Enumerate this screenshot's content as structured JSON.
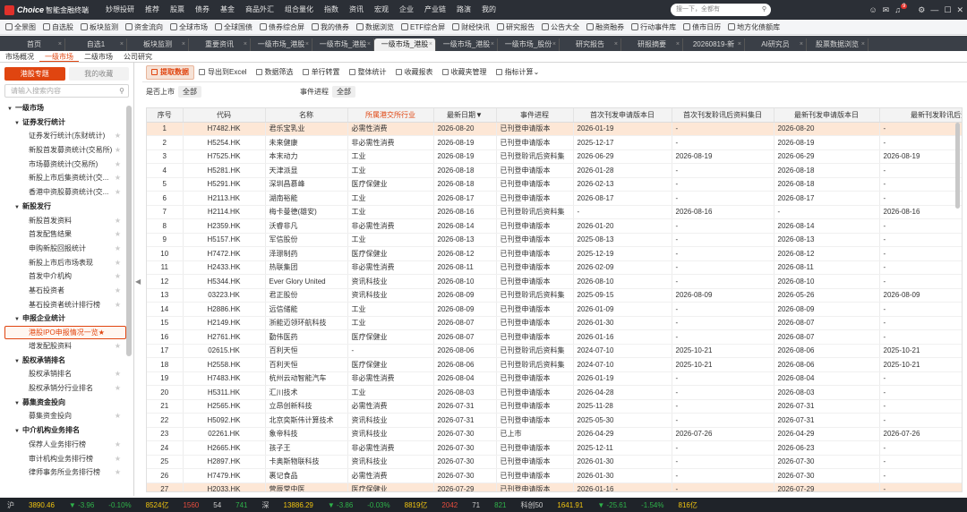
{
  "app": {
    "logo_brand": "Choice",
    "logo_name": "智能金融终端",
    "menu": [
      "妙想投研",
      "推荐",
      "股票",
      "债券",
      "基金",
      "商品外汇",
      "组合量化",
      "指数",
      "资讯",
      "宏观",
      "企业",
      "产业链",
      "路演",
      "我的"
    ],
    "search_placeholder": "搜一下，全都有",
    "search_icon": "search-icon",
    "notification_count": "9"
  },
  "toolbar": [
    "全景图",
    "自选股",
    "板块监测",
    "资金流向",
    "全球市场",
    "全球国债",
    "债券综合屏",
    "我的债券",
    "数据浏览",
    "ETF综合屏",
    "财经快讯",
    "研究报告",
    "公告大全",
    "融资融券",
    "行动事件库",
    "债市日历",
    "地方化债额库"
  ],
  "tabs": [
    "首页",
    "自选1",
    "板块监测",
    "重要资讯",
    "一级市场_港股",
    "一级市场_港股",
    "一级市场_港股",
    "一级市场_港股",
    "一级市场_股份",
    "研究报告",
    "研报摘要",
    "20260819-新",
    "AI研究员",
    "股票数据浏览"
  ],
  "active_tab_index": 6,
  "subtabs": [
    "市场概况",
    "一级市场",
    "二级市场",
    "公司研究"
  ],
  "active_subtab_index": 1,
  "sidebar": {
    "tabs": [
      "港股专题",
      "我的收藏"
    ],
    "search_placeholder": "请输入搜索内容",
    "tree": [
      {
        "level": "g1",
        "label": "一级市场"
      },
      {
        "level": "g2",
        "label": "证券发行统计"
      },
      {
        "level": "lf",
        "label": "证券发行统计(东财统计)"
      },
      {
        "level": "lf",
        "label": "新股首发募资统计(交易所)"
      },
      {
        "level": "lf",
        "label": "市场募资统计(交易所)"
      },
      {
        "level": "lf",
        "label": "新股上市后集资统计(交..."
      },
      {
        "level": "lf",
        "label": "香港中资股募资统计(交..."
      },
      {
        "level": "g2",
        "label": "新股发行"
      },
      {
        "level": "lf",
        "label": "新股首发资料"
      },
      {
        "level": "lf",
        "label": "首发配售结果"
      },
      {
        "level": "lf",
        "label": "申购新股回报统计"
      },
      {
        "level": "lf",
        "label": "新股上市后市场表现"
      },
      {
        "level": "lf",
        "label": "首发中介机构"
      },
      {
        "level": "lf",
        "label": "基石投资者"
      },
      {
        "level": "lf",
        "label": "基石投资者统计排行榜"
      },
      {
        "level": "g2",
        "label": "申报企业统计"
      },
      {
        "level": "sel",
        "label": "港股IPO申报情况一览"
      },
      {
        "level": "lf",
        "label": "增发配股资料"
      },
      {
        "level": "g2",
        "label": "股权承销排名"
      },
      {
        "level": "lf",
        "label": "股权承销排名"
      },
      {
        "level": "lf",
        "label": "股权承销分行业排名"
      },
      {
        "level": "g2",
        "label": "募集资金投向"
      },
      {
        "level": "lf",
        "label": "募集资金投向"
      },
      {
        "level": "g2",
        "label": "中介机构业务排名"
      },
      {
        "level": "lf",
        "label": "保荐人业务排行榜"
      },
      {
        "level": "lf",
        "label": "审计机构业务排行榜"
      },
      {
        "level": "lf",
        "label": "律师事务所业务排行榜"
      }
    ]
  },
  "actions": [
    "提取数据",
    "导出到Excel",
    "数据筛选",
    "单行转置",
    "整体统计",
    "收藏报表",
    "收藏夹管理",
    "指标计算"
  ],
  "filters": {
    "listed_label": "是否上市",
    "listed_value": "全部",
    "progress_label": "事件进程",
    "progress_value": "全部"
  },
  "table": {
    "columns": [
      "序号",
      "代码",
      "名称",
      "所属港交所行业",
      "最新日期",
      "事件进程",
      "首次刊发申请版本日",
      "首次刊发聆讯后资料集日",
      "最新刊发申请版本日",
      "最新刊发聆讯后资料"
    ],
    "sort_indicator": "▼",
    "rows": [
      [
        "1",
        "H7482.HK",
        "君乐宝乳业",
        "必需性消费",
        "2026-08-20",
        "已刊登申请版本",
        "2026-01-19",
        "-",
        "2026-08-20",
        "-"
      ],
      [
        "2",
        "H5254.HK",
        "未来健康",
        "非必需性消费",
        "2026-08-19",
        "已刊登申请版本",
        "2025-12-17",
        "-",
        "2026-08-19",
        "-"
      ],
      [
        "3",
        "H7525.HK",
        "本末动力",
        "工业",
        "2026-08-19",
        "已刊登聆讯后资料集",
        "2026-06-29",
        "2026-08-19",
        "2026-06-29",
        "2026-08-19"
      ],
      [
        "4",
        "H5281.HK",
        "天津派显",
        "工业",
        "2026-08-18",
        "已刊登申请版本",
        "2026-01-28",
        "-",
        "2026-08-18",
        "-"
      ],
      [
        "5",
        "H5291.HK",
        "深圳昌慕峰",
        "医疗保健业",
        "2026-08-18",
        "已刊登申请版本",
        "2026-02-13",
        "-",
        "2026-08-18",
        "-"
      ],
      [
        "6",
        "H2113.HK",
        "湖南裕能",
        "工业",
        "2026-08-17",
        "已刊登申请版本",
        "2026-08-17",
        "-",
        "2026-08-17",
        "-"
      ],
      [
        "7",
        "H2114.HK",
        "梅卡曼德(雄安)",
        "工业",
        "2026-08-16",
        "已刊登聆讯后资料集",
        "-",
        "2026-08-16",
        "-",
        "2026-08-16"
      ],
      [
        "8",
        "H2359.HK",
        "沃睿非凡",
        "非必需性消费",
        "2026-08-14",
        "已刊登申请版本",
        "2026-01-20",
        "-",
        "2026-08-14",
        "-"
      ],
      [
        "9",
        "H5157.HK",
        "军信股份",
        "工业",
        "2026-08-13",
        "已刊登申请版本",
        "2025-08-13",
        "-",
        "2026-08-13",
        "-"
      ],
      [
        "10",
        "H7472.HK",
        "泽璟制药",
        "医疗保健业",
        "2026-08-12",
        "已刊登申请版本",
        "2025-12-19",
        "-",
        "2026-08-12",
        "-"
      ],
      [
        "11",
        "H2433.HK",
        "热联集团",
        "非必需性消费",
        "2026-08-11",
        "已刊登申请版本",
        "2026-02-09",
        "-",
        "2026-08-11",
        "-"
      ],
      [
        "12",
        "H5344.HK",
        "Ever Glory United",
        "资讯科技业",
        "2026-08-10",
        "已刊登申请版本",
        "2026-08-10",
        "-",
        "2026-08-10",
        "-"
      ],
      [
        "13",
        "03223.HK",
        "君正股份",
        "资讯科技业",
        "2026-08-09",
        "已刊登聆讯后资料集",
        "2025-09-15",
        "2026-08-09",
        "2026-05-26",
        "2026-08-09"
      ],
      [
        "14",
        "H2886.HK",
        "远信储能",
        "工业",
        "2026-08-09",
        "已刊登申请版本",
        "2026-01-09",
        "-",
        "2026-08-09",
        "-"
      ],
      [
        "15",
        "H2149.HK",
        "浙能迈领环航科技",
        "工业",
        "2026-08-07",
        "已刊登申请版本",
        "2026-01-30",
        "-",
        "2026-08-07",
        "-"
      ],
      [
        "16",
        "H2761.HK",
        "勤伟医药",
        "医疗保健业",
        "2026-08-07",
        "已刊登申请版本",
        "2026-01-16",
        "-",
        "2026-08-07",
        "-"
      ],
      [
        "17",
        "02615.HK",
        "百利天恒",
        "-",
        "2026-08-06",
        "已刊登聆讯后资料集",
        "2024-07-10",
        "2025-10-21",
        "2026-08-06",
        "2025-10-21"
      ],
      [
        "18",
        "H2558.HK",
        "百利天恒",
        "医疗保健业",
        "2026-08-06",
        "已刊登聆讯后资料集",
        "2024-07-10",
        "2025-10-21",
        "2026-08-06",
        "2025-10-21"
      ],
      [
        "19",
        "H7483.HK",
        "杭州云动智能汽车",
        "非必需性消费",
        "2026-08-04",
        "已刊登申请版本",
        "2026-01-19",
        "-",
        "2026-08-04",
        "-"
      ],
      [
        "20",
        "H5311.HK",
        "汇川技术",
        "工业",
        "2026-08-03",
        "已刊登申请版本",
        "2026-04-28",
        "-",
        "2026-08-03",
        "-"
      ],
      [
        "21",
        "H2565.HK",
        "立昂创新科技",
        "必需性消费",
        "2026-07-31",
        "已刊登申请版本",
        "2025-11-28",
        "-",
        "2026-07-31",
        "-"
      ],
      [
        "22",
        "H5092.HK",
        "北京奕斯伟计算技术",
        "资讯科技业",
        "2026-07-31",
        "已刊登申请版本",
        "2025-05-30",
        "-",
        "2026-07-31",
        "-"
      ],
      [
        "23",
        "02261.HK",
        "象帝科技",
        "资讯科技业",
        "2026-07-30",
        "已上市",
        "2026-04-29",
        "2026-07-26",
        "2026-04-29",
        "2026-07-26"
      ],
      [
        "24",
        "H2665.HK",
        "孩子王",
        "非必需性消费",
        "2026-07-30",
        "已刊登申请版本",
        "2025-12-11",
        "-",
        "2026-06-23",
        "-"
      ],
      [
        "25",
        "H2897.HK",
        "卡奥斯物联科技",
        "资讯科技业",
        "2026-07-30",
        "已刊登申请版本",
        "2026-01-30",
        "-",
        "2026-07-30",
        "-"
      ],
      [
        "26",
        "H7479.HK",
        "裹记食品",
        "必需性消费",
        "2026-07-30",
        "已刊登申请版本",
        "2026-01-30",
        "-",
        "2026-07-30",
        "-"
      ],
      [
        "27",
        "H2033.HK",
        "营辰堂中医",
        "医疗保健业",
        "2026-07-29",
        "已刊登申请版本",
        "2026-01-16",
        "-",
        "2026-07-29",
        "-"
      ],
      [
        "28",
        "H2046.HK",
        "深圳粤十控股",
        "资讯科技业",
        "2026-07-29",
        "已刊登申请版本",
        "2026-01-26",
        "-",
        "2026-07-29",
        "-"
      ]
    ],
    "highlighted_rows": [
      0,
      26
    ]
  },
  "status": {
    "sh_label": "沪",
    "sh_index": "3890.46",
    "sh_chg": "▼ -3.96",
    "sh_pct": "-0.10%",
    "sh_vol": "8524亿",
    "sh_up": "1560",
    "sh_flat": "54",
    "sh_down": "741",
    "sz_label": "深",
    "sz_index": "13886.29",
    "sz_chg": "▼ -3.86",
    "sz_pct": "-0.03%",
    "sz_vol": "8819亿",
    "sz_up": "2042",
    "sz_flat": "71",
    "sz_down": "821",
    "kc_label": "科创50",
    "kc_index": "1641.91",
    "kc_chg": "▼ -25.61",
    "kc_pct": "-1.54%",
    "kc_vol": "816亿"
  }
}
